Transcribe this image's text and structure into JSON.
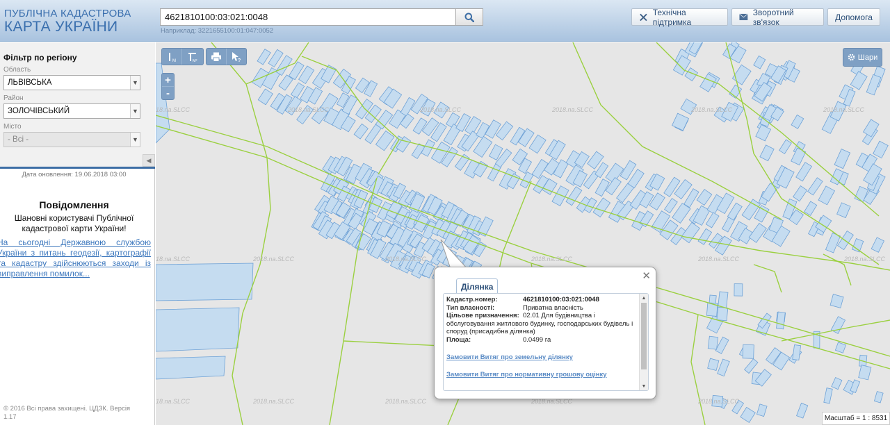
{
  "header": {
    "logo_line1": "ПУБЛІЧНА КАДАСТРОВА",
    "logo_line2": "КАРТА УКРАЇНИ",
    "search_value": "4621810100:03:021:0048",
    "search_example": "Наприклад: 3221655100:01:047:0052",
    "support_label": "Технічна підтримка",
    "feedback_label": "Зворотний зв'язок",
    "help_label": "Допомога"
  },
  "sidebar": {
    "filter_title": "Фільтр по регіону",
    "oblast_label": "Область",
    "oblast_value": "ЛЬВІВСЬКА",
    "rayon_label": "Район",
    "rayon_value": "ЗОЛОЧІВСЬКИЙ",
    "misto_label": "Місто",
    "misto_value": "- Всі -",
    "update_date": "Дата оновлення: 19.06.2018 03:00",
    "message_title": "Повідомлення",
    "message_greeting": "Шановні користувачі Публічної кадастрової карти України!",
    "message_link": "На сьогодні Державною службою України з питань геодезії, картографії та кадастру здійснюються заходи із виправлення помилок...",
    "copyright": "© 2016 Всі права захищені. ЦДЗК. Версія 1.17"
  },
  "map": {
    "layers_label": "Шари",
    "scale_label": "Масштаб = 1 : 8531",
    "watermark": "2018.na.SLCC"
  },
  "popup": {
    "tab_label": "Ділянка",
    "cadastral_key": "Кадастр.номер:",
    "cadastral_value": "4621810100:03:021:0048",
    "ownership_key": "Тип власності:",
    "ownership_value": "Приватна власність",
    "purpose_key": "Цільове призначення:",
    "purpose_value": "02.01 Для будівництва і обслуговування житлового будинку, господарських будівель і споруд (присадибна ділянка)",
    "area_key": "Площа:",
    "area_value": "0.0499 га",
    "link_extract": "Замовити Витяг про земельну ділянку",
    "link_valuation": "Замовити Витяг про нормативну грошову оцінку"
  },
  "colors": {
    "parcel_fill": "#c5dcf0",
    "parcel_stroke": "#6fa2d6",
    "boundary": "#9bd040",
    "toolbar": "#7fa0c4",
    "header_text": "#3a6fae"
  }
}
